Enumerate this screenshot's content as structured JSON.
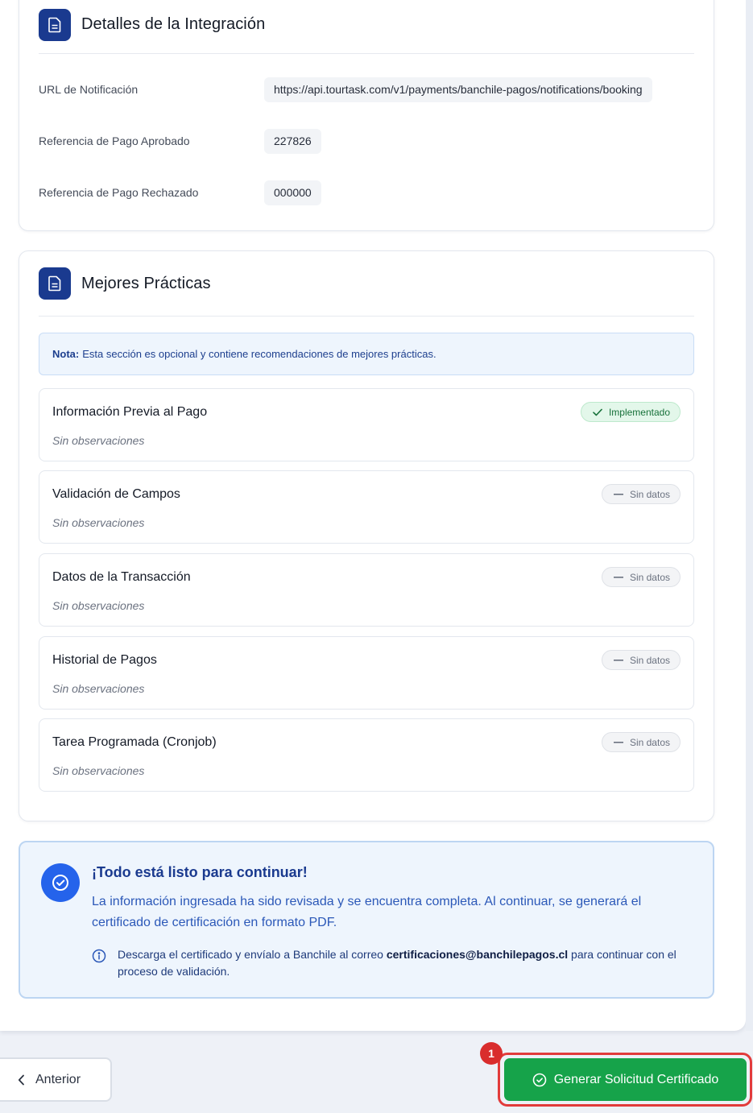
{
  "integracion": {
    "title": "Detalles de la Integración",
    "fields": [
      {
        "label": "URL de Notificación",
        "value": "https://api.tourtask.com/v1/payments/banchile-pagos/notifications/booking"
      },
      {
        "label": "Referencia de Pago Aprobado",
        "value": "227826"
      },
      {
        "label": "Referencia de Pago Rechazado",
        "value": "000000"
      }
    ]
  },
  "practicas": {
    "title": "Mejores Prácticas",
    "note_label": "Nota:",
    "note_text": "Esta sección es opcional y contiene recomendaciones de mejores prácticas.",
    "items": [
      {
        "title": "Información Previa al Pago",
        "obs": "Sin observaciones",
        "status": "Implementado"
      },
      {
        "title": "Validación de Campos",
        "obs": "Sin observaciones",
        "status": "Sin datos"
      },
      {
        "title": "Datos de la Transacción",
        "obs": "Sin observaciones",
        "status": "Sin datos"
      },
      {
        "title": "Historial de Pagos",
        "obs": "Sin observaciones",
        "status": "Sin datos"
      },
      {
        "title": "Tarea Programada (Cronjob)",
        "obs": "Sin observaciones",
        "status": "Sin datos"
      }
    ]
  },
  "ready": {
    "title": "¡Todo está listo para continuar!",
    "text": "La información ingresada ha sido revisada y se encuentra completa. Al continuar, se generará el certificado de certificación en formato PDF.",
    "info_before": "Descarga el certificado y envíalo a Banchile al correo ",
    "info_email": "certificaciones@banchilepagos.cl",
    "info_after": " para continuar con el proceso de validación."
  },
  "nav": {
    "prev_label": "Anterior",
    "generate_label": "Generar Solicitud Certificado",
    "step_number": "1"
  },
  "icons": {
    "header": "document-icon",
    "implemented": "check-icon",
    "no_data": "dash-icon",
    "ready": "check-circle-icon",
    "info": "info-icon",
    "prev": "chevron-left-icon",
    "generate": "check-circle-icon"
  },
  "colors": {
    "primary_dark": "#1a3a8f",
    "accent_blue": "#2563eb",
    "success": "#16a34a",
    "highlight": "#e23b3b"
  }
}
